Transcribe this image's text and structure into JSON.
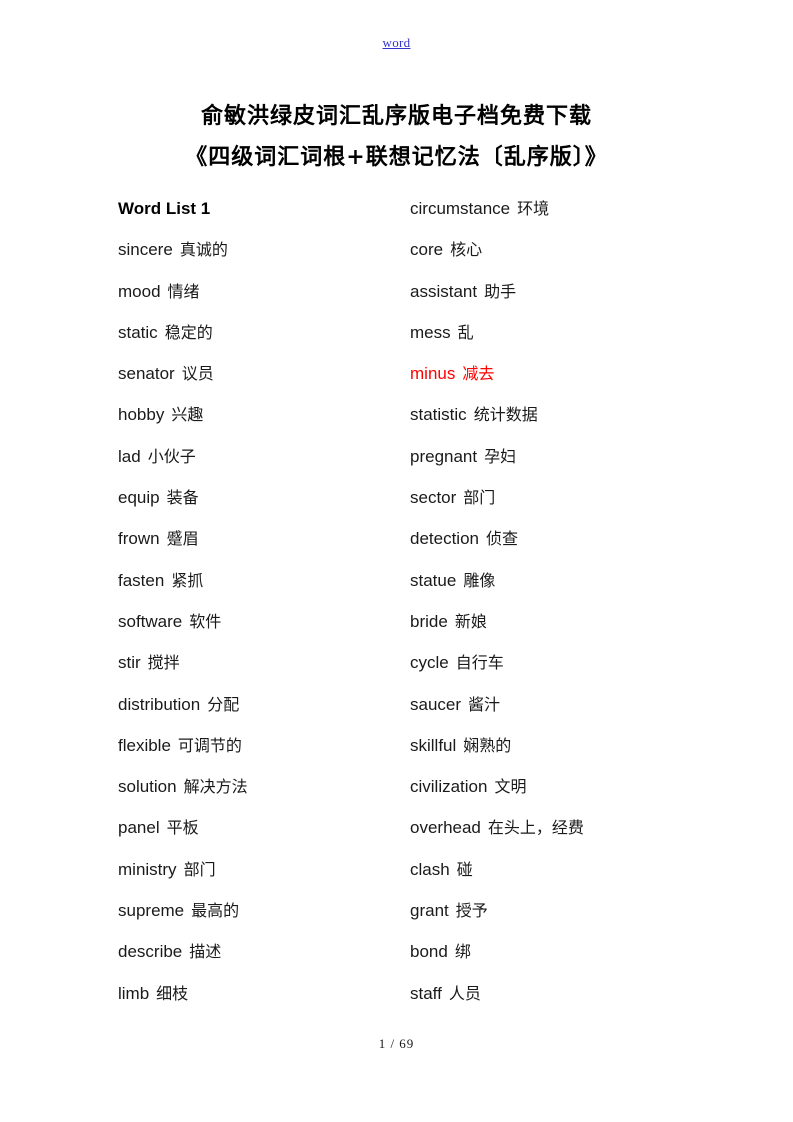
{
  "header": {
    "link_label": "word"
  },
  "title": {
    "line1": "俞敏洪绿皮词汇乱序版电子档免费下载",
    "line2": "《四级词汇词根+联想记忆法〔乱序版〕》"
  },
  "left_column": {
    "list_header": "Word List 1",
    "entries": [
      {
        "en": "sincere",
        "cn": "真诚的"
      },
      {
        "en": "mood",
        "cn": "情绪"
      },
      {
        "en": "static",
        "cn": "稳定的"
      },
      {
        "en": "senator",
        "cn": "议员"
      },
      {
        "en": "hobby",
        "cn": "兴趣"
      },
      {
        "en": "lad",
        "cn": "小伙子"
      },
      {
        "en": "equip",
        "cn": "装备"
      },
      {
        "en": "frown",
        "cn": "蹙眉"
      },
      {
        "en": "fasten",
        "cn": "紧抓"
      },
      {
        "en": "software",
        "cn": "软件"
      },
      {
        "en": "stir",
        "cn": "搅拌"
      },
      {
        "en": "distribution",
        "cn": "分配"
      },
      {
        "en": "flexible",
        "cn": "可调节的"
      },
      {
        "en": "solution",
        "cn": "解决方法"
      },
      {
        "en": "panel",
        "cn": "平板"
      },
      {
        "en": "ministry",
        "cn": "部门"
      },
      {
        "en": "supreme",
        "cn": "最高的"
      },
      {
        "en": "describe",
        "cn": "描述"
      },
      {
        "en": "limb",
        "cn": "细枝"
      }
    ]
  },
  "right_column": {
    "entries": [
      {
        "en": "circumstance",
        "cn": "环境"
      },
      {
        "en": "core",
        "cn": "核心"
      },
      {
        "en": "assistant",
        "cn": "助手"
      },
      {
        "en": "mess",
        "cn": "乱"
      },
      {
        "en": "minus",
        "cn": "减去",
        "color": "#ff0000"
      },
      {
        "en": "statistic",
        "cn": "统计数据"
      },
      {
        "en": "pregnant",
        "cn": "孕妇"
      },
      {
        "en": "sector",
        "cn": "部门"
      },
      {
        "en": "detection",
        "cn": "侦查"
      },
      {
        "en": "statue",
        "cn": "雕像"
      },
      {
        "en": "bride",
        "cn": "新娘"
      },
      {
        "en": "cycle",
        "cn": "自行车"
      },
      {
        "en": "saucer",
        "cn": "酱汁"
      },
      {
        "en": "skillful",
        "cn": "娴熟的"
      },
      {
        "en": "civilization",
        "cn": "文明"
      },
      {
        "en": "overhead",
        "cn": "在头上，经费"
      },
      {
        "en": "clash",
        "cn": "碰"
      },
      {
        "en": "grant",
        "cn": "授予"
      },
      {
        "en": "bond",
        "cn": "绑"
      },
      {
        "en": "staff",
        "cn": "人员"
      }
    ]
  },
  "footer": {
    "page_label": "1 / 69"
  }
}
